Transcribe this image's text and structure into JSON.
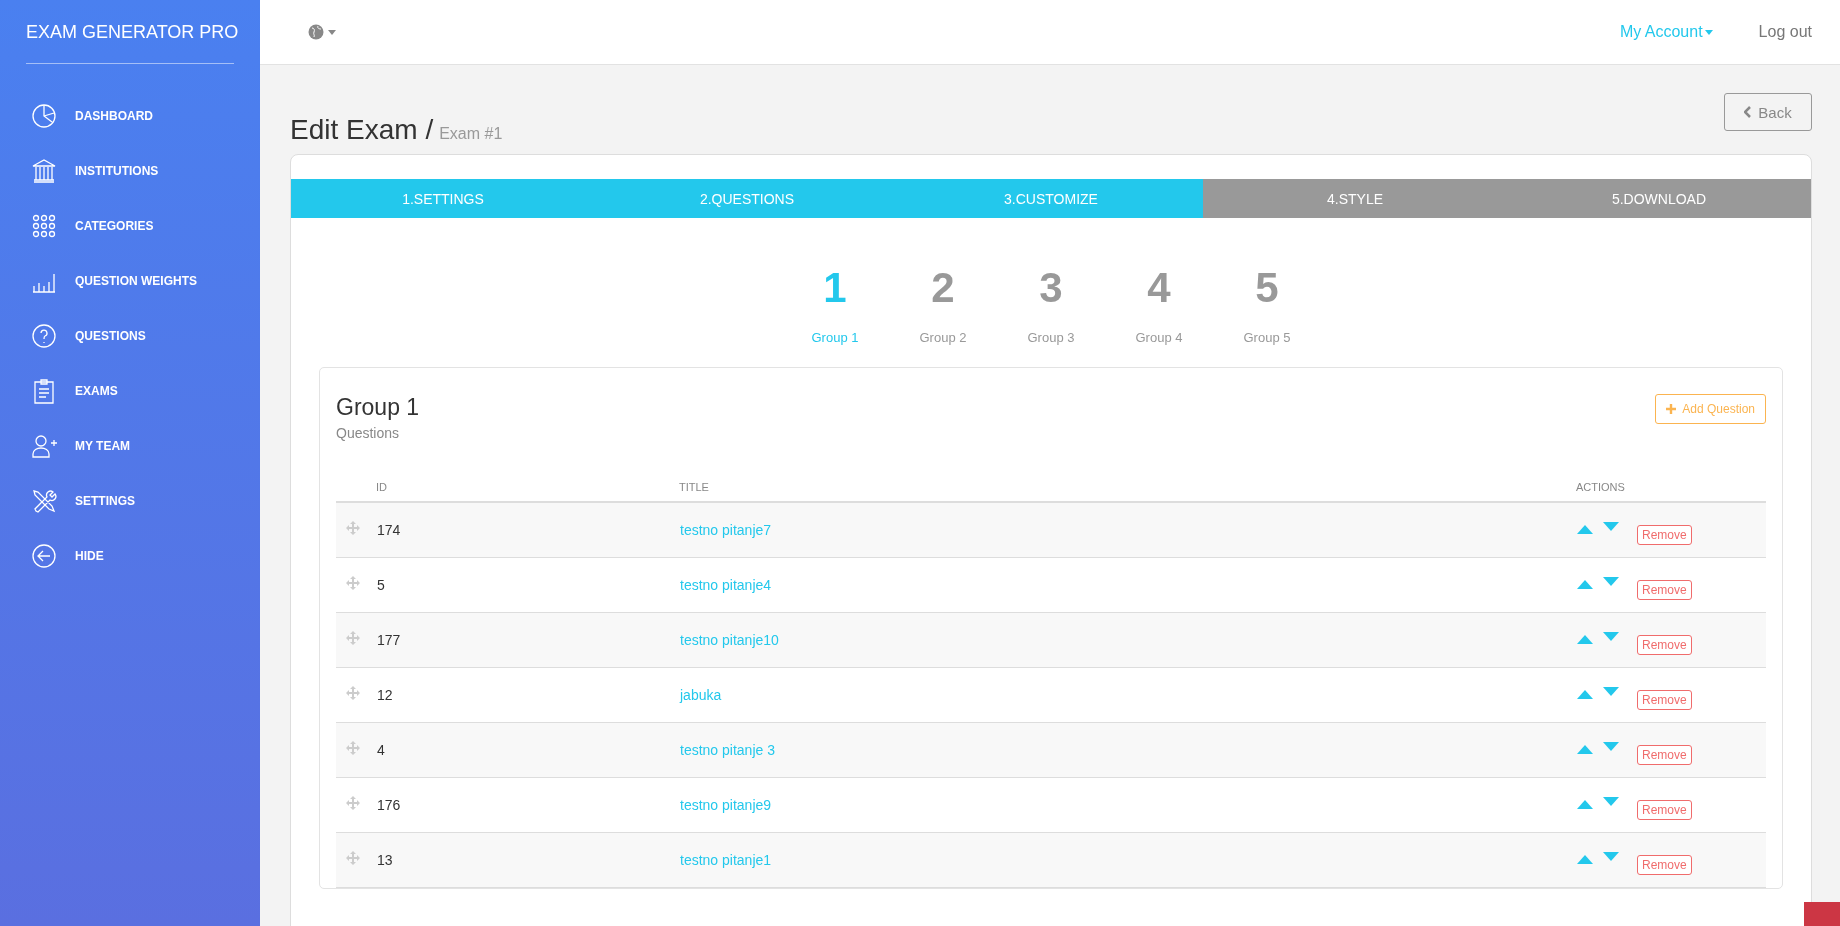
{
  "sidebar": {
    "brand": "EXAM GENERATOR PRO",
    "items": [
      {
        "kind": "pie",
        "label": "DASHBOARD"
      },
      {
        "kind": "bank",
        "label": "INSTITUTIONS"
      },
      {
        "kind": "dots",
        "label": "CATEGORIES"
      },
      {
        "kind": "bars",
        "label": "QUESTION WEIGHTS"
      },
      {
        "kind": "help",
        "label": "QUESTIONS"
      },
      {
        "kind": "clipboard",
        "label": "EXAMS"
      },
      {
        "kind": "user",
        "label": "MY TEAM"
      },
      {
        "kind": "tools",
        "label": "SETTINGS"
      },
      {
        "kind": "back",
        "label": "HIDE"
      }
    ]
  },
  "topbar": {
    "account": "My Account",
    "logout": "Log out"
  },
  "page": {
    "title": "Edit Exam",
    "separator": "/",
    "subtitle": "Exam #1",
    "back": "Back"
  },
  "wizard": [
    {
      "label": "1.SETTINGS",
      "done": true
    },
    {
      "label": "2.QUESTIONS",
      "done": true
    },
    {
      "label": "3.CUSTOMIZE",
      "done": true
    },
    {
      "label": "4.STYLE",
      "done": false
    },
    {
      "label": "5.DOWNLOAD",
      "done": false
    }
  ],
  "groups": [
    {
      "number": "1",
      "label": "Group 1",
      "selected": true
    },
    {
      "number": "2",
      "label": "Group 2",
      "selected": false
    },
    {
      "number": "3",
      "label": "Group 3",
      "selected": false
    },
    {
      "number": "4",
      "label": "Group 4",
      "selected": false
    },
    {
      "number": "5",
      "label": "Group 5",
      "selected": false
    }
  ],
  "panel": {
    "title": "Group 1",
    "subtitle": "Questions",
    "add": "Add Question"
  },
  "table": {
    "columns": [
      "ID",
      "TITLE",
      "ACTIONS"
    ],
    "rows": [
      {
        "id": "174",
        "title": "testno pitanje7",
        "remove": "Remove"
      },
      {
        "id": "5",
        "title": "testno pitanje4",
        "remove": "Remove"
      },
      {
        "id": "177",
        "title": "testno pitanje10",
        "remove": "Remove"
      },
      {
        "id": "12",
        "title": "jabuka",
        "remove": "Remove"
      },
      {
        "id": "4",
        "title": "testno pitanje 3",
        "remove": "Remove"
      },
      {
        "id": "176",
        "title": "testno pitanje9",
        "remove": "Remove"
      },
      {
        "id": "13",
        "title": "testno pitanje1",
        "remove": "Remove"
      }
    ]
  }
}
